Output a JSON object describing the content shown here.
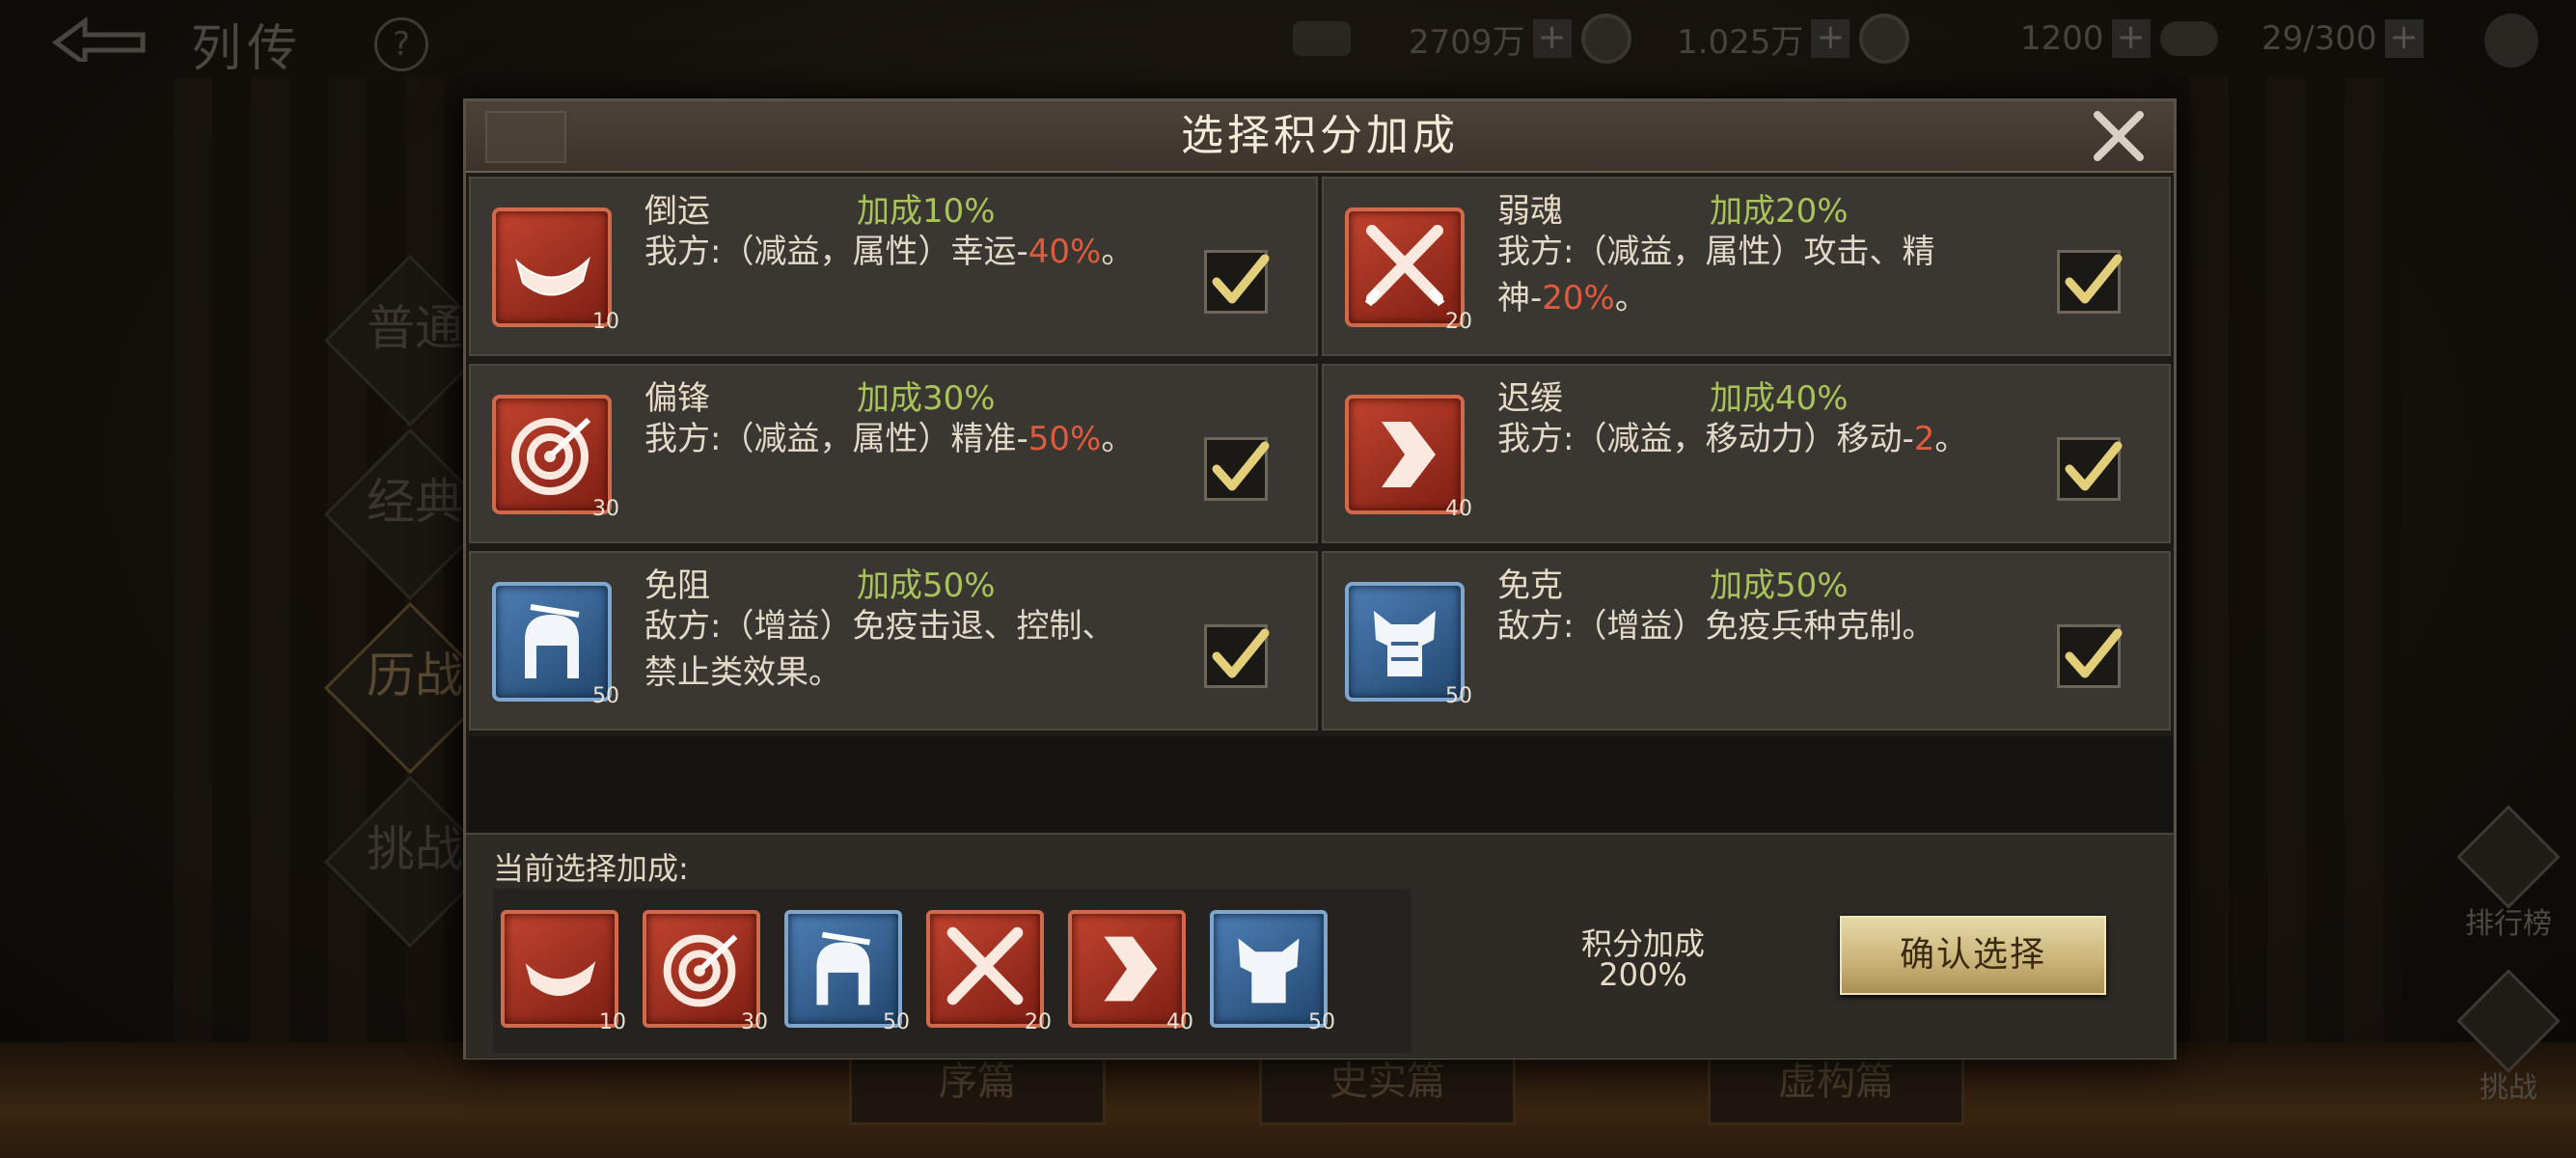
{
  "topbar": {
    "title": "列传",
    "help": "?",
    "resources": [
      {
        "value": "2709万"
      },
      {
        "value": "1.025万"
      },
      {
        "value": "1200"
      },
      {
        "value": "29/300"
      }
    ]
  },
  "background": {
    "side_tabs": [
      "普通",
      "经典",
      "历战",
      "挑战"
    ],
    "right_buttons": [
      "排行榜",
      "挑战"
    ],
    "bottom_tabs": [
      "序篇",
      "史实篇",
      "虚构篇"
    ]
  },
  "dialog": {
    "title": "选择积分加成",
    "cards": [
      {
        "name": "倒运",
        "bonus": "加成10%",
        "desc": "我方:（减益，属性）幸运-",
        "highlight": "40%",
        "suffix": "。",
        "level": "10",
        "color": "red",
        "icon": "horn-icon",
        "checked": true
      },
      {
        "name": "弱魂",
        "bonus": "加成20%",
        "desc": "我方:（减益，属性）攻击、精神-",
        "highlight": "20%",
        "suffix": "。",
        "level": "20",
        "color": "red",
        "icon": "crossed-swords-icon",
        "checked": true
      },
      {
        "name": "偏锋",
        "bonus": "加成30%",
        "desc": "我方:（减益，属性）精准-",
        "highlight": "50%",
        "suffix": "。",
        "level": "30",
        "color": "red",
        "icon": "target-icon",
        "checked": true
      },
      {
        "name": "迟缓",
        "bonus": "加成40%",
        "desc": "我方:（减益，移动力）移动-",
        "highlight": "2",
        "suffix": "。",
        "level": "40",
        "color": "red",
        "icon": "chevron-icon",
        "checked": true
      },
      {
        "name": "免阻",
        "bonus": "加成50%",
        "desc": "敌方:（增益）免疫击退、控制、禁止类效果。",
        "highlight": "",
        "suffix": "",
        "level": "50",
        "color": "blue",
        "icon": "helmet-icon",
        "checked": true
      },
      {
        "name": "免克",
        "bonus": "加成50%",
        "desc": "敌方:（增益）免疫兵种克制。",
        "highlight": "",
        "suffix": "",
        "level": "50",
        "color": "blue",
        "icon": "armor-icon",
        "checked": true
      }
    ],
    "current_label": "当前选择加成:",
    "selected": [
      {
        "icon": "horn-icon",
        "color": "red",
        "level": "10"
      },
      {
        "icon": "target-icon",
        "color": "red",
        "level": "30"
      },
      {
        "icon": "helmet-icon",
        "color": "blue",
        "level": "50"
      },
      {
        "icon": "crossed-swords-icon",
        "color": "red",
        "level": "20"
      },
      {
        "icon": "chevron-icon",
        "color": "red",
        "level": "40"
      },
      {
        "icon": "armor-icon",
        "color": "blue",
        "level": "50"
      }
    ],
    "score_label": "积分加成",
    "score_value": "200%",
    "confirm_label": "确认选择"
  }
}
